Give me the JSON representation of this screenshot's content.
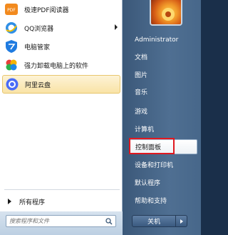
{
  "programs": [
    {
      "label": "极速PDF阅读器",
      "icon": "pdf-reader-icon",
      "has_submenu": false
    },
    {
      "label": "QQ浏览器",
      "icon": "qq-browser-icon",
      "has_submenu": true
    },
    {
      "label": "电脑管家",
      "icon": "pc-manager-icon",
      "has_submenu": false
    },
    {
      "label": "强力卸载电脑上的软件",
      "icon": "uninstaller-icon",
      "has_submenu": false
    },
    {
      "label": "阿里云盘",
      "icon": "aliyun-drive-icon",
      "has_submenu": false
    }
  ],
  "all_programs_label": "所有程序",
  "search": {
    "placeholder": "搜索程序和文件"
  },
  "right_items": [
    {
      "label": "Administrator"
    },
    {
      "label": "文档"
    },
    {
      "label": "图片"
    },
    {
      "label": "音乐"
    },
    {
      "label": "游戏"
    },
    {
      "label": "计算机"
    },
    {
      "label": "控制面板"
    },
    {
      "label": "设备和打印机"
    },
    {
      "label": "默认程序"
    },
    {
      "label": "帮助和支持"
    }
  ],
  "shutdown_label": "关机",
  "colors": {
    "highlight": "#f9e3a6",
    "annotation": "#e0181f",
    "right_pane": "#47678a"
  }
}
